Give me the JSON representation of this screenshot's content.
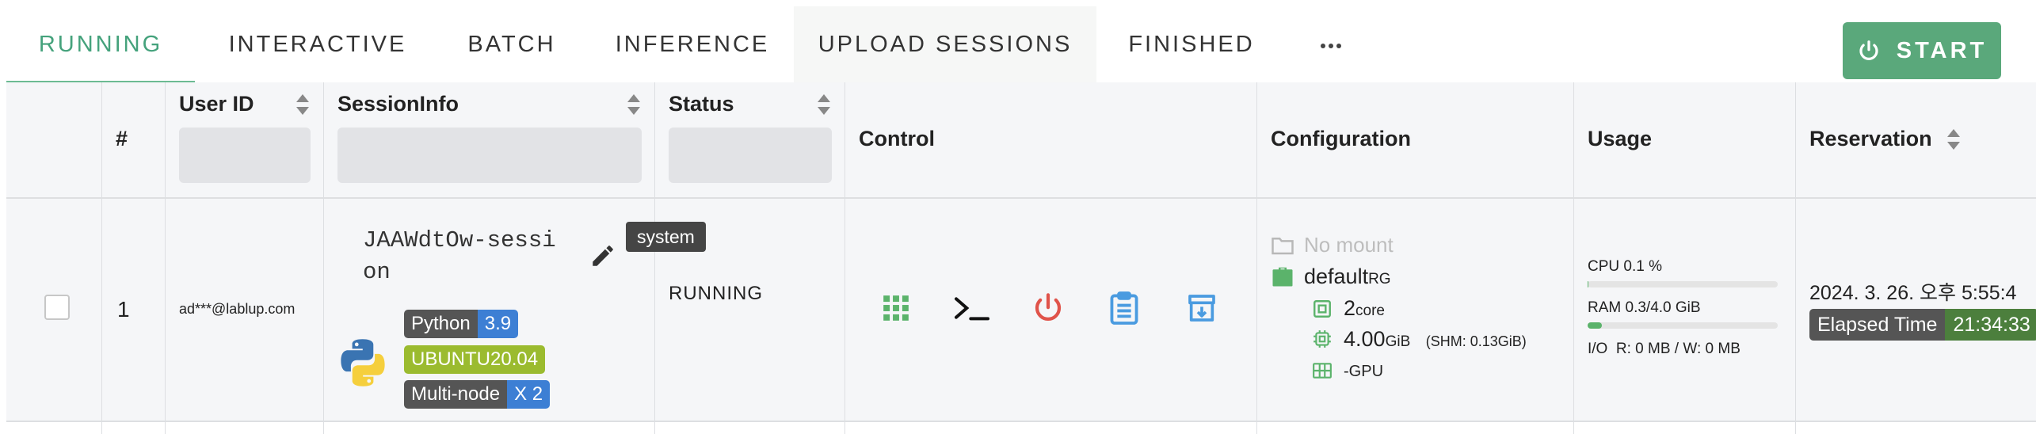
{
  "tabs": [
    {
      "label": "RUNNING",
      "active": true
    },
    {
      "label": "INTERACTIVE"
    },
    {
      "label": "BATCH"
    },
    {
      "label": "INFERENCE"
    },
    {
      "label": "UPLOAD SESSIONS"
    },
    {
      "label": "FINISHED"
    }
  ],
  "more_icon": "ellipsis-icon",
  "start_button": {
    "label": "START",
    "icon": "power-icon"
  },
  "table": {
    "headers": {
      "index": "#",
      "user_id": "User ID",
      "session_info": "SessionInfo",
      "status": "Status",
      "control": "Control",
      "configuration": "Configuration",
      "usage": "Usage",
      "reservation": "Reservation"
    },
    "rows": [
      {
        "index": "1",
        "user_id": "ad***@lablup.com",
        "session_name": "JAAWdtOw-session",
        "tooltip": "system",
        "kernel_icon": "python-logo",
        "tags": {
          "lang_name": "Python",
          "lang_version": "3.9",
          "os": "UBUNTU20.04",
          "mode": "Multi-node",
          "mode_count": "X 2"
        },
        "status": "RUNNING",
        "controls": [
          "apps-icon",
          "terminal-icon",
          "power-icon",
          "log-icon",
          "download-icon"
        ],
        "configuration": {
          "mount": "No mount",
          "resource_group": "default",
          "resource_group_suffix": "RG",
          "cpu_value": "2",
          "cpu_unit": "core",
          "mem_value": "4.00",
          "mem_unit": "GiB",
          "shm": "(SHM: 0.13GiB)",
          "gpu_value": "-",
          "gpu_unit": "GPU"
        },
        "usage": {
          "cpu_label": "CPU 0.1 %",
          "cpu_fraction": 0.001,
          "ram_label": "RAM 0.3/4.0 GiB",
          "ram_fraction": 0.075,
          "io_label": "I/O",
          "io_value": "R: 0 MB / W: 0 MB"
        },
        "reservation": {
          "datetime": "2024. 3. 26. 오후 5:55:4",
          "elapsed_label": "Elapsed Time",
          "elapsed_value": "21:34:33"
        }
      }
    ]
  },
  "colors": {
    "accent": "#45a27c",
    "start_button": "#5aa87b",
    "power_red": "#e0534a",
    "icon_blue": "#4a9be0",
    "icon_green": "#5bb36b",
    "tag_lime": "#9bbb2f",
    "tag_blue": "#3d7fd4"
  }
}
